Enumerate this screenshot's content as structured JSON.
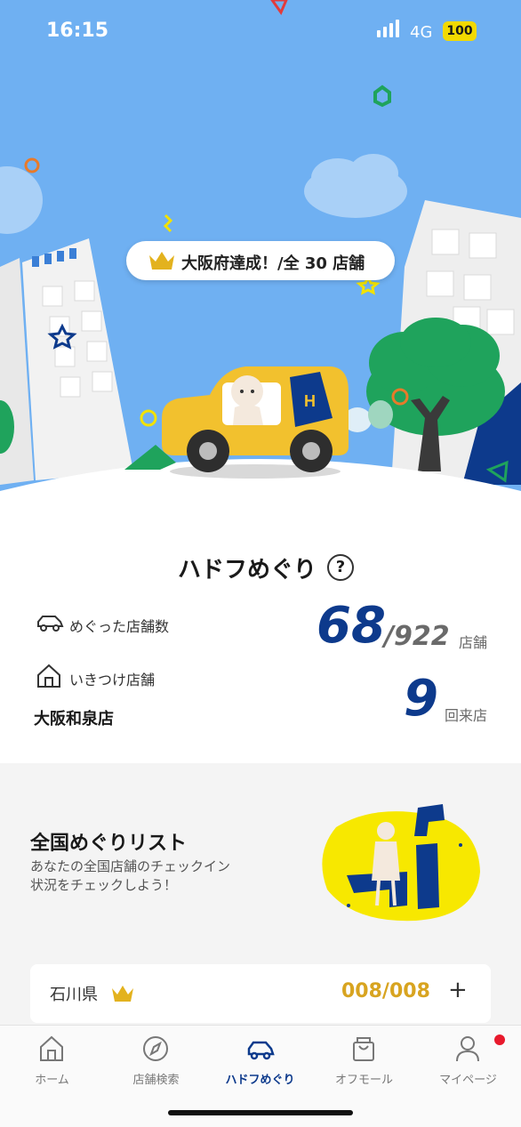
{
  "status_bar": {
    "time": "16:15",
    "network": "4G",
    "battery": "100"
  },
  "hero": {
    "badge_text": "大阪府達成！/全 30 店舗",
    "car_letter": "H"
  },
  "stats": {
    "title": "ハドフめぐり",
    "help_symbol": "?",
    "visited_label": "めぐった店舗数",
    "visited_count": "68",
    "total_stores": "/922",
    "stores_unit": "店舗",
    "home_label": "いきつけ店舗",
    "home_store": "大阪和泉店",
    "visit_count": "9",
    "visit_unit": "回来店"
  },
  "national": {
    "title": "全国めぐりリスト",
    "description": "あなたの全国店舗のチェックイン状況をチェックしよう！",
    "prefecture": "石川県",
    "progress": "008/008",
    "expand": "+"
  },
  "tabs": [
    {
      "label": "ホーム",
      "icon": "home-icon"
    },
    {
      "label": "店舗検索",
      "icon": "compass-icon"
    },
    {
      "label": "ハドフめぐり",
      "icon": "car-icon"
    },
    {
      "label": "オフモール",
      "icon": "shopping-bag-icon"
    },
    {
      "label": "マイページ",
      "icon": "user-icon"
    }
  ],
  "colors": {
    "sky": "#6fb0f2",
    "accent_navy": "#0d3a8c",
    "gold": "#d8a420",
    "car_yellow": "#f2c12e",
    "tree_green": "#1fa35c"
  }
}
